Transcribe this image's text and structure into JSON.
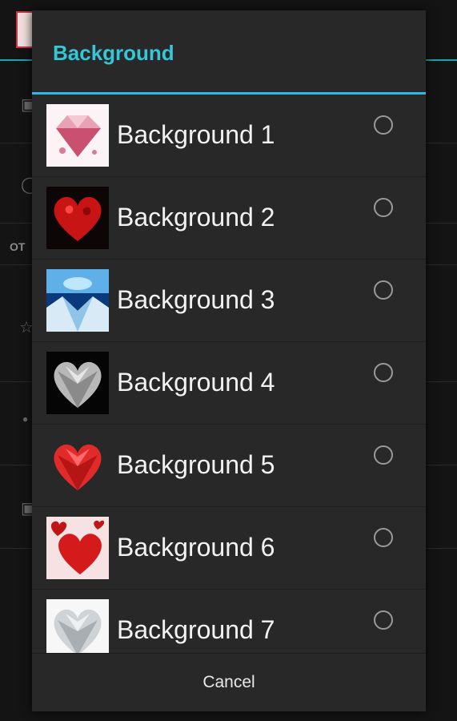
{
  "dialog": {
    "title": "Background",
    "cancel_label": "Cancel",
    "items": [
      {
        "label": "Background 1",
        "thumb": "pink-diamond-thumbnail",
        "selected": false
      },
      {
        "label": "Background 2",
        "thumb": "red-rose-heart-thumbnail",
        "selected": false
      },
      {
        "label": "Background 3",
        "thumb": "blue-diamond-thumbnail",
        "selected": false
      },
      {
        "label": "Background 4",
        "thumb": "silver-heart-thumbnail",
        "selected": false
      },
      {
        "label": "Background 5",
        "thumb": "red-gem-heart-thumbnail",
        "selected": false
      },
      {
        "label": "Background 6",
        "thumb": "red-hearts-thumbnail",
        "selected": false
      },
      {
        "label": "Background 7",
        "thumb": "crystal-heart-thumbnail",
        "selected": false
      }
    ]
  },
  "background_screen": {
    "section_label": "OT"
  },
  "colors": {
    "accent": "#33b5e5",
    "title": "#35c6d8",
    "dialog_bg": "#282828"
  }
}
